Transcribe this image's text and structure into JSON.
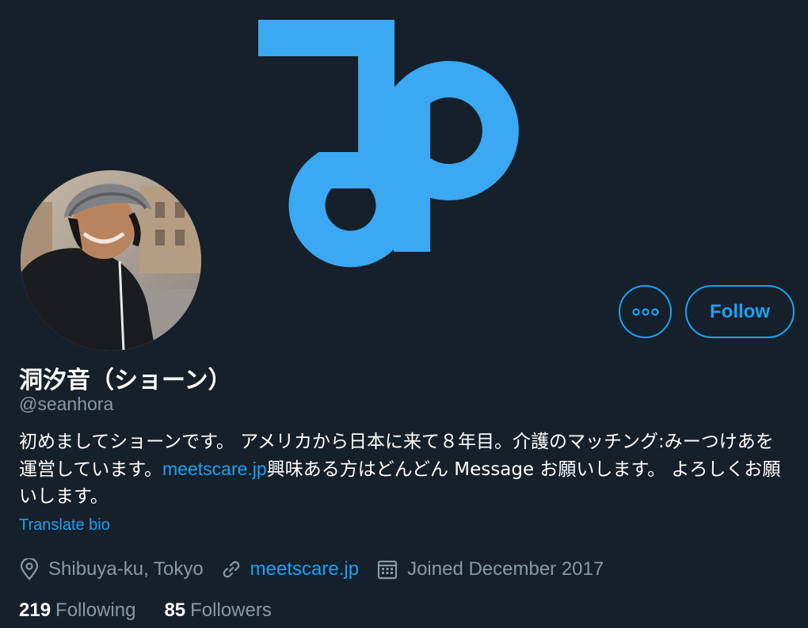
{
  "profile": {
    "display_name": "洞汐音（ショーン）",
    "handle": "@seanhora",
    "bio_part1": "初めましてショーンです。 アメリカから日本に来て８年目。介護のマッチング:みーつけあを運営しています。",
    "bio_link": "meetscare.jp",
    "bio_part2": "興味ある方はどんどん Message お願いします。 よろしくお願いします。",
    "translate_label": "Translate bio",
    "location": "Shibuya-ku, Tokyo",
    "website": "meetscare.jp",
    "joined": "Joined December 2017"
  },
  "actions": {
    "follow_label": "Follow",
    "more_icon": "more-horizontal-icon"
  },
  "stats": {
    "following_count": "219",
    "following_label": "Following",
    "followers_count": "85",
    "followers_label": "Followers"
  },
  "icons": {
    "location": "location-pin-icon",
    "link": "link-icon",
    "calendar": "calendar-icon"
  },
  "colors": {
    "background": "#15202b",
    "accent": "#1da1f2",
    "secondary_text": "#8899a6",
    "banner_logo": "#3aa8f2"
  }
}
